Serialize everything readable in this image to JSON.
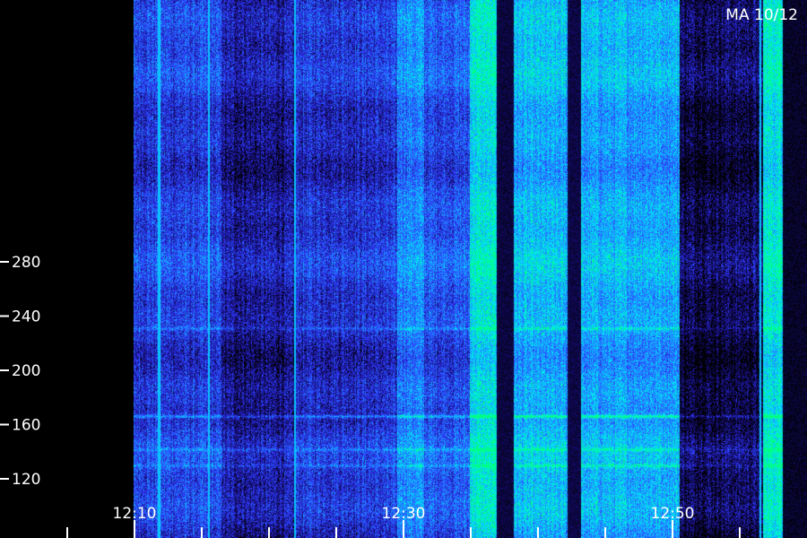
{
  "chart_data": {
    "type": "heatmap",
    "title": "",
    "corner_label": "MA 10/12",
    "xlabel": "",
    "ylabel": "",
    "y_ticks": [
      {
        "value": 120,
        "label": "120"
      },
      {
        "value": 160,
        "label": "160"
      },
      {
        "value": 200,
        "label": "200"
      },
      {
        "value": 240,
        "label": "240"
      },
      {
        "value": 280,
        "label": "280"
      }
    ],
    "ylim": [
      105,
      300
    ],
    "x_ticks_labeled": [
      {
        "minute": 10,
        "label": "12:10"
      },
      {
        "minute": 30,
        "label": "12:30"
      },
      {
        "minute": 50,
        "label": "12:50"
      }
    ],
    "x_minor_tick_minutes": [
      5,
      10,
      15,
      20,
      25,
      30,
      35,
      40,
      45,
      50,
      55
    ],
    "xlim_minutes": [
      0,
      59
    ],
    "colormap": [
      "#000000",
      "#1a0f8c",
      "#2f3cff",
      "#1e90ff",
      "#00e5ff",
      "#00ff80"
    ],
    "no_data_until_minute": 9.9,
    "intensity_bands": [
      {
        "from": 9.9,
        "to": 16.5,
        "level": 0.38
      },
      {
        "from": 16.5,
        "to": 22.0,
        "level": 0.22
      },
      {
        "from": 22.0,
        "to": 29.5,
        "level": 0.34
      },
      {
        "from": 29.5,
        "to": 31.5,
        "level": 0.58
      },
      {
        "from": 31.5,
        "to": 34.9,
        "level": 0.44
      },
      {
        "from": 34.9,
        "to": 36.9,
        "level": 0.82
      },
      {
        "from": 36.9,
        "to": 38.2,
        "level": 0.03
      },
      {
        "from": 38.2,
        "to": 42.2,
        "level": 0.68
      },
      {
        "from": 42.2,
        "to": 43.2,
        "level": 0.04
      },
      {
        "from": 43.2,
        "to": 50.5,
        "level": 0.66
      },
      {
        "from": 50.5,
        "to": 53.8,
        "level": 0.1
      },
      {
        "from": 53.8,
        "to": 56.7,
        "level": 0.12
      },
      {
        "from": 56.7,
        "to": 58.2,
        "level": 0.84
      },
      {
        "from": 58.2,
        "to": 59.0,
        "level": 0.0
      }
    ],
    "vertical_lines_minutes": [
      11.8,
      15.5,
      21.9,
      56.5
    ],
    "horizontal_lines_values": [
      166,
      231,
      142,
      130
    ]
  }
}
